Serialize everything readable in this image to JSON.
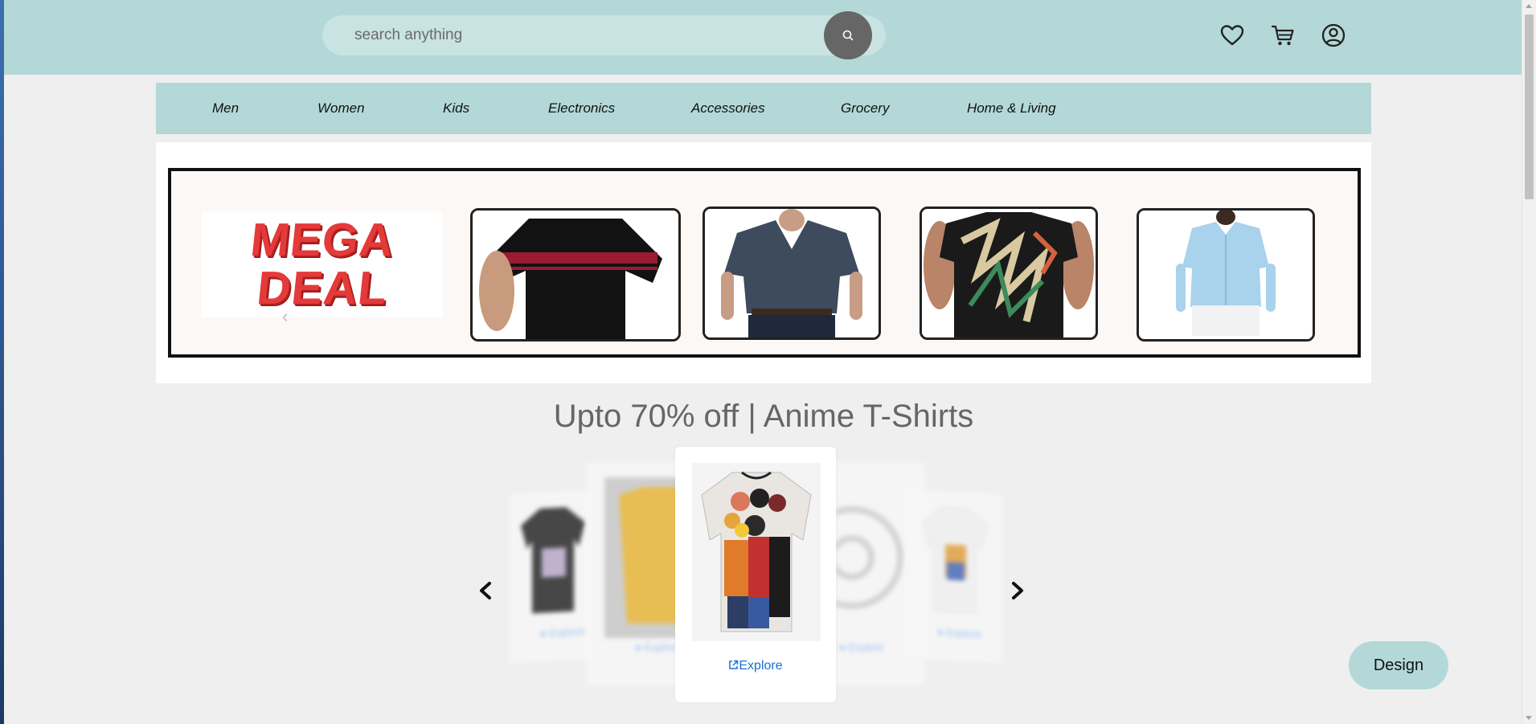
{
  "header": {
    "search": {
      "placeholder": "search anything",
      "value": ""
    },
    "icons": [
      "search-icon",
      "heart-icon",
      "cart-icon",
      "user-icon"
    ]
  },
  "categories": [
    "Men",
    "Women",
    "Kids",
    "Electronics",
    "Accessories",
    "Grocery",
    "Home & Living"
  ],
  "banner": {
    "mega_deal_line1": "MEGA",
    "mega_deal_line2": "DEAL",
    "products": [
      "black t-shirt with red stripe",
      "navy v-neck t-shirt",
      "geometric print t-shirt",
      "light blue shirt"
    ]
  },
  "anime_section": {
    "title": "Upto 70% off | Anime T-Shirts",
    "explore_label": "Explore"
  },
  "design_button": "Design",
  "colors": {
    "accent": "#b4d8d8",
    "search_button": "#666666",
    "link": "#1a6fd6",
    "title": "#666666"
  }
}
